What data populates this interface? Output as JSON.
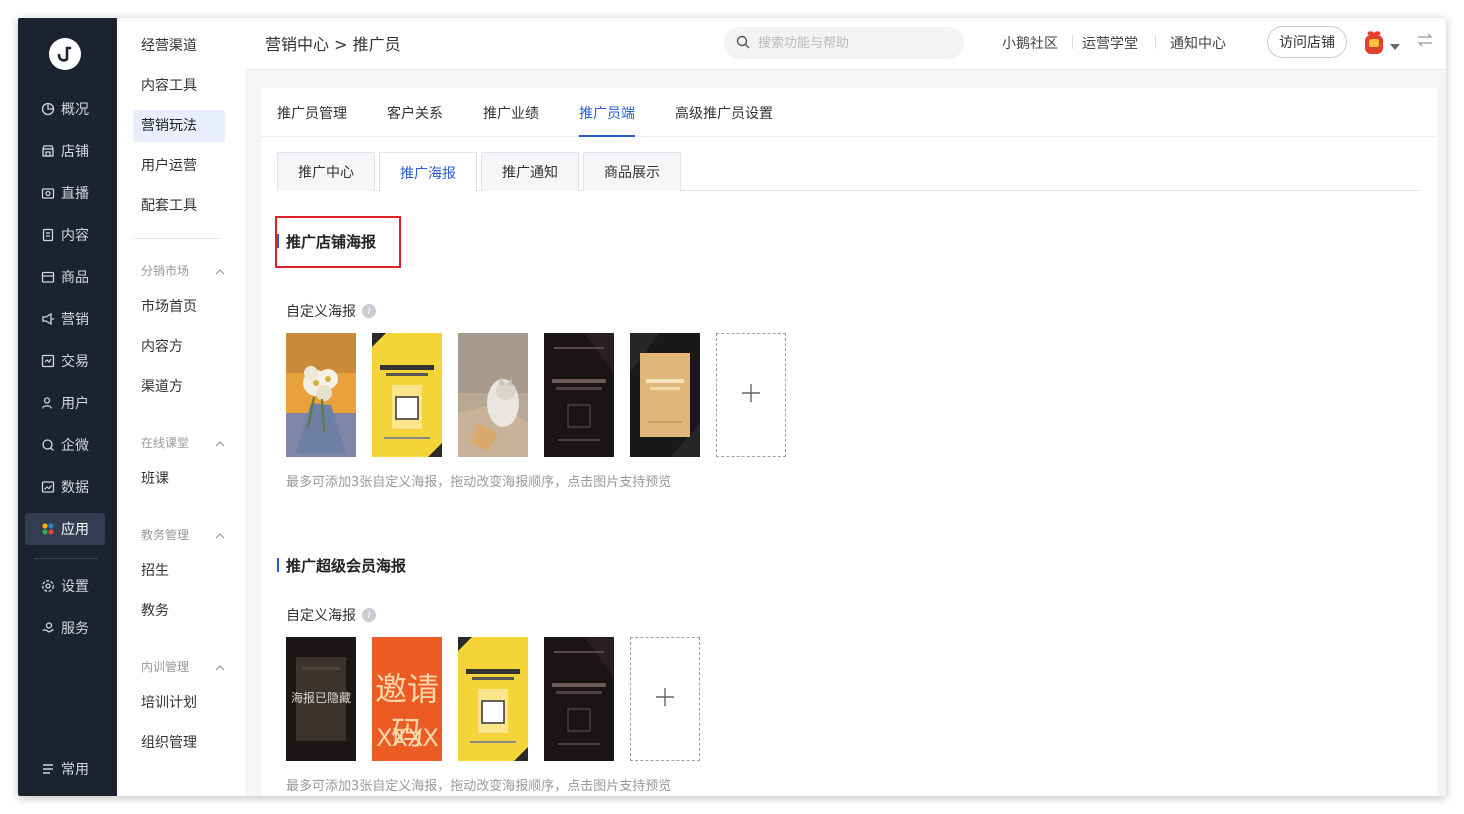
{
  "nav": {
    "items": [
      {
        "label": "概况",
        "icon": "pie-chart-icon"
      },
      {
        "label": "店铺",
        "icon": "store-icon"
      },
      {
        "label": "直播",
        "icon": "live-camera-icon"
      },
      {
        "label": "内容",
        "icon": "document-icon"
      },
      {
        "label": "商品",
        "icon": "box-icon"
      },
      {
        "label": "营销",
        "icon": "megaphone-icon"
      },
      {
        "label": "交易",
        "icon": "transaction-icon"
      },
      {
        "label": "用户",
        "icon": "user-icon"
      },
      {
        "label": "企微",
        "icon": "wecom-icon"
      },
      {
        "label": "数据",
        "icon": "data-icon"
      },
      {
        "label": "应用",
        "icon": "apps-icon"
      }
    ],
    "active": "应用",
    "bottom_items": [
      {
        "label": "设置",
        "icon": "gear-icon"
      },
      {
        "label": "服务",
        "icon": "service-icon"
      }
    ],
    "common_label": "常用"
  },
  "subnav": {
    "top_items": [
      "经营渠道",
      "内容工具",
      "营销玩法",
      "用户运营",
      "配套工具"
    ],
    "active": "营销玩法",
    "groups": [
      {
        "title": "分销市场",
        "items": [
          "市场首页",
          "内容方",
          "渠道方"
        ]
      },
      {
        "title": "在线课堂",
        "items": [
          "班课"
        ]
      },
      {
        "title": "教务管理",
        "items": [
          "招生",
          "教务"
        ]
      },
      {
        "title": "内训管理",
        "items": [
          "培训计划",
          "组织管理"
        ]
      }
    ]
  },
  "header": {
    "breadcrumb": "营销中心 > 推广员",
    "search_placeholder": "搜索功能与帮助",
    "links": [
      "小鹅社区",
      "运营学堂",
      "通知中心"
    ],
    "visit_store": "访问店铺"
  },
  "tabs": [
    "推广员管理",
    "客户关系",
    "推广业绩",
    "推广员端",
    "高级推广员设置"
  ],
  "active_tab": "推广员端",
  "subtabs": [
    "推广中心",
    "推广海报",
    "推广通知",
    "商品展示"
  ],
  "active_subtab": "推广海报",
  "sections": [
    {
      "title": "推广店铺海报",
      "custom_label": "自定义海报",
      "hint": "最多可添加3张自定义海报，拖动改变海报顺序，点击图片支持预览"
    },
    {
      "title": "推广超级会员海报",
      "custom_label": "自定义海报",
      "hint": "最多可添加3张自定义海报，拖动改变海报顺序，点击图片支持预览",
      "hidden_poster_text": "海报已隐藏",
      "invite_code_title": "邀请码",
      "invite_code_value": "XXXX"
    }
  ],
  "colors": {
    "accent": "#2a5bd7",
    "nav_bg": "#1d2230",
    "highlight": "#e0202b"
  }
}
